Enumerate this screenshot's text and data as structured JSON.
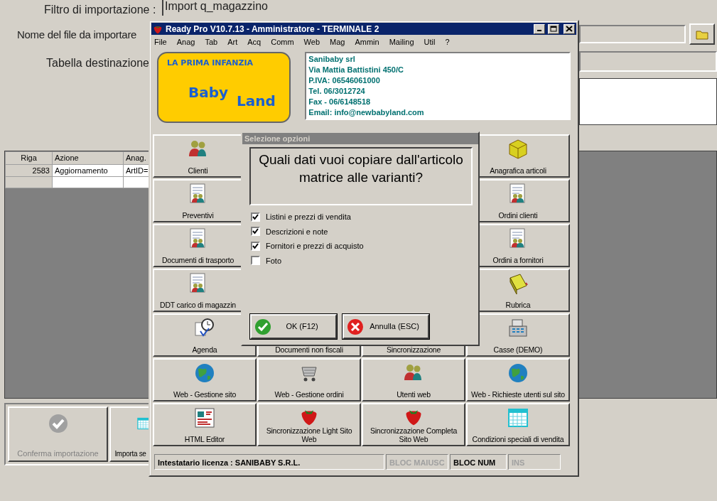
{
  "import_window": {
    "fields": [
      {
        "label": "Filtro di importazione :",
        "value": "Import q_magazzino"
      },
      {
        "label": "Nome del file da importare"
      },
      {
        "label": "Tabella destinazione"
      }
    ],
    "table": {
      "columns": [
        "Riga",
        "Azione",
        "Anag."
      ],
      "rows": [
        [
          "2583",
          "Aggiornamento",
          "ArtID="
        ]
      ]
    },
    "buttons": [
      {
        "label": "Conferma importazione",
        "disabled": true,
        "kind": "check"
      },
      {
        "label": "Importa se",
        "disabled": false,
        "kind": "calendar"
      }
    ]
  },
  "main_window": {
    "title": "Ready Pro V10.7.13 - Amministratore - TERMINALE 2",
    "menu": [
      "File",
      "Anag",
      "Tab",
      "Art",
      "Acq",
      "Comm",
      "Web",
      "Mag",
      "Ammin",
      "Mailing",
      "Util",
      "?"
    ],
    "logo": {
      "lines": [
        "LA PRIMA INFANZIA",
        "Baby",
        "Land"
      ]
    },
    "company_info": [
      "Sanibaby srl",
      "Via Mattia Battistini 450/C",
      "P.IVA: 06546061000",
      "Tel. 06/3012724",
      "Fax - 06/6148518",
      "Email: info@newbabyland.com"
    ],
    "tile_rows": [
      [
        {
          "label": "Clienti",
          "kind": "people"
        },
        {
          "label": "Anagrafica articoli",
          "kind": "box"
        }
      ],
      [
        {
          "label": "Preventivi",
          "kind": "document"
        },
        {
          "label": "Ordini clienti",
          "kind": "document"
        }
      ],
      [
        {
          "label": "Documenti di trasporto",
          "kind": "document"
        },
        {
          "label": "Ordini a fornitori",
          "kind": "document"
        }
      ],
      [
        {
          "label": "DDT carico di magazzin",
          "kind": "document"
        },
        {
          "label": "Rubrica",
          "kind": "book"
        }
      ],
      [
        {
          "label": "Agenda",
          "kind": "clock"
        },
        {
          "label": "Documenti non fiscali",
          "kind": "plain"
        },
        {
          "label": "Sincronizzazione",
          "kind": "plain"
        },
        {
          "label": "Casse (DEMO)",
          "kind": "register"
        }
      ],
      [
        {
          "label": "Web - Gestione sito",
          "kind": "globe"
        },
        {
          "label": "Web - Gestione ordini",
          "kind": "cart"
        },
        {
          "label": "Utenti web",
          "kind": "people"
        },
        {
          "label": "Web - Richieste utenti sul sito",
          "kind": "globe"
        }
      ],
      [
        {
          "label": "HTML Editor",
          "kind": "editor"
        },
        {
          "label": "Sincronizzazione Light Sito Web",
          "kind": "strawberry"
        },
        {
          "label": "Sincronizzazione Completa Sito Web",
          "kind": "strawberry"
        },
        {
          "label": "Condizioni speciali di vendita",
          "kind": "calendar"
        }
      ]
    ],
    "status_bar": {
      "license": "Intestatario licenza : SANIBABY S.R.L.",
      "indicators": [
        {
          "label": "BLOC MAIUSC",
          "on": false
        },
        {
          "label": "BLOC NUM",
          "on": true
        },
        {
          "label": "INS",
          "on": false
        }
      ]
    }
  },
  "dialog": {
    "title": "Selezione opzioni",
    "question": "Quali dati vuoi copiare dall'articolo matrice alle varianti?",
    "options": [
      {
        "label": "Listini e prezzi di vendita",
        "checked": true
      },
      {
        "label": "Descrizioni e note",
        "checked": true
      },
      {
        "label": "Fornitori e prezzi di acquisto",
        "checked": true
      },
      {
        "label": "Foto",
        "checked": false
      }
    ],
    "buttons": [
      {
        "label": "OK (F12)",
        "kind": "ok"
      },
      {
        "label": "Annulla (ESC)",
        "kind": "cancel"
      }
    ]
  }
}
